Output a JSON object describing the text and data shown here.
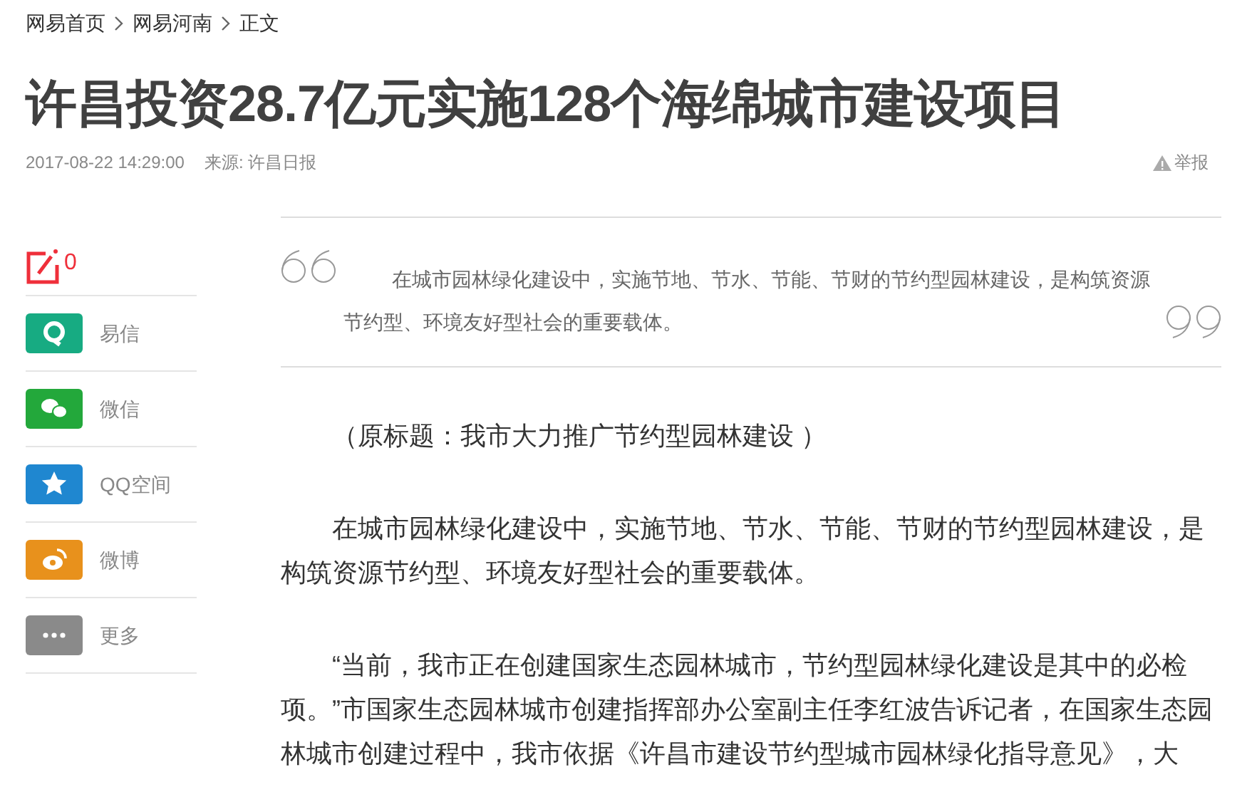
{
  "breadcrumb": [
    "网易首页",
    "网易河南",
    "正文"
  ],
  "title": "许昌投资28.7亿元实施128个海绵城市建设项目",
  "meta": {
    "time": "2017-08-22 14:29:00",
    "source": "来源: 许昌日报",
    "report": "举报"
  },
  "comments": {
    "count": "0"
  },
  "share": [
    {
      "kind": "yixin",
      "label": "易信",
      "color": "#17ab82"
    },
    {
      "kind": "wechat",
      "label": "微信",
      "color": "#23a83b"
    },
    {
      "kind": "qzone",
      "label": "QQ空间",
      "color": "#1f87d0"
    },
    {
      "kind": "weibo",
      "label": "微博",
      "color": "#e8911c"
    },
    {
      "kind": "more",
      "label": "更多",
      "color": "#8a8a8a"
    }
  ],
  "summary": "在城市园林绿化建设中，实施节地、节水、节能、节财的节约型园林建设，是构筑资源节约型、环境友好型社会的重要载体。",
  "paragraphs": [
    "（原标题：我市大力推广节约型园林建设 ）",
    "在城市园林绿化建设中，实施节地、节水、节能、节财的节约型园林建设，是构筑资源节约型、环境友好型社会的重要载体。",
    "“当前，我市正在创建国家生态园林城市，节约型园林绿化建设是其中的必检项。”市国家生态园林城市创建指挥部办公室副主任李红波告诉记者，在国家生态园林城市创建过程中，我市依据《许昌市建设节约型城市园林绿化指导意见》，大"
  ]
}
